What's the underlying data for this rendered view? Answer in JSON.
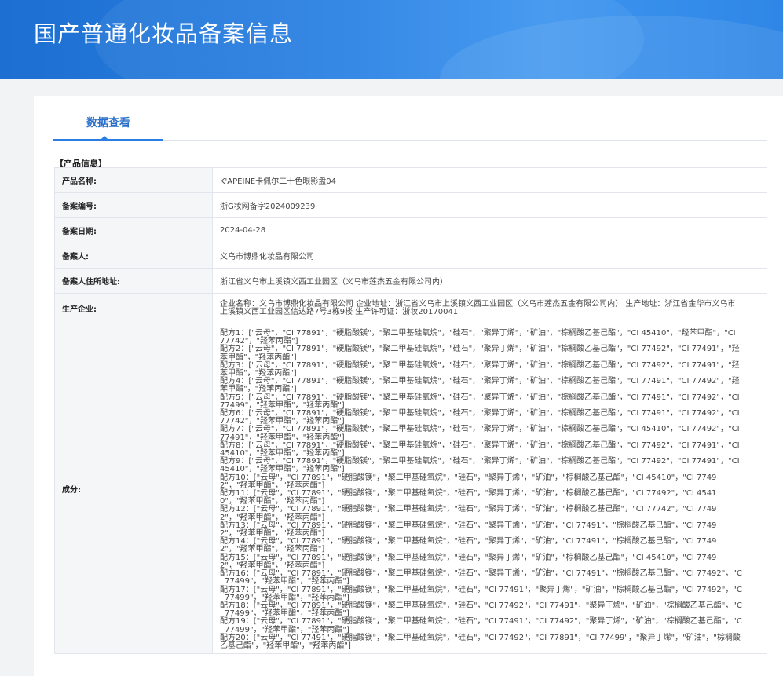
{
  "banner": {
    "title": "国产普通化妆品备案信息"
  },
  "tab": {
    "label": "数据查看"
  },
  "section": {
    "title": "【产品信息】"
  },
  "rows": {
    "product_name": {
      "label": "产品名称:",
      "value": "K'APEINE卡佩尔二十色眼影盘04"
    },
    "record_no": {
      "label": "备案编号:",
      "value": "浙G妆网备字2024009239"
    },
    "record_date": {
      "label": "备案日期:",
      "value": "2024-04-28"
    },
    "registrant": {
      "label": "备案人:",
      "value": "义乌市博鼎化妆品有限公司"
    },
    "registrant_address": {
      "label": "备案人住所地址:",
      "value": "浙江省义乌市上溪镇义西工业园区（义乌市莲杰五金有限公司内）"
    },
    "manufacturer": {
      "label": "生产企业:",
      "value": "企业名称：义乌市博鼎化妆品有限公司 企业地址：浙江省义乌市上溪镇义西工业园区（义乌市莲杰五金有限公司内） 生产地址：浙江省金华市义乌市上溪镇义西工业园区信达路7号3栋9楼 生产许可证：浙妆20170041"
    },
    "ingredients": {
      "label": "成分:",
      "formulas": [
        "配方1：[\"云母\"，\"CI 77891\"，\"硬脂酸镁\"，\"聚二甲基硅氧烷\"，\"硅石\"，\"聚异丁烯\"，\"矿油\"，\"棕榈酸乙基己酯\"，\"CI 45410\"，\"羟苯甲酯\"，\"CI 77742\"，\"羟苯丙酯\"]",
        "配方2：[\"云母\"，\"CI 77891\"，\"硬脂酸镁\"，\"聚二甲基硅氧烷\"，\"硅石\"，\"聚异丁烯\"，\"矿油\"，\"棕榈酸乙基己酯\"，\"CI 77492\"，\"CI 77491\"，\"羟苯甲酯\"，\"羟苯丙酯\"]",
        "配方3：[\"云母\"，\"CI 77891\"，\"硬脂酸镁\"，\"聚二甲基硅氧烷\"，\"硅石\"，\"聚异丁烯\"，\"矿油\"，\"棕榈酸乙基己酯\"，\"CI 77492\"，\"CI 77491\"，\"羟苯甲酯\"，\"羟苯丙酯\"]",
        "配方4：[\"云母\"，\"CI 77891\"，\"硬脂酸镁\"，\"聚二甲基硅氧烷\"，\"硅石\"，\"聚异丁烯\"，\"矿油\"，\"棕榈酸乙基己酯\"，\"CI 77491\"，\"CI 77492\"，\"羟苯甲酯\"，\"羟苯丙酯\"]",
        "配方5：[\"云母\"，\"CI 77891\"，\"硬脂酸镁\"，\"聚二甲基硅氧烷\"，\"硅石\"，\"聚异丁烯\"，\"矿油\"，\"棕榈酸乙基己酯\"，\"CI 77491\"，\"CI 77492\"，\"CI 77499\"，\"羟苯甲酯\"，\"羟苯丙酯\"]",
        "配方6：[\"云母\"，\"CI 77891\"，\"硬脂酸镁\"，\"聚二甲基硅氧烷\"，\"硅石\"，\"聚异丁烯\"，\"矿油\"，\"棕榈酸乙基己酯\"，\"CI 77491\"，\"CI 77492\"，\"CI 77742\"，\"羟苯甲酯\"，\"羟苯丙酯\"]",
        "配方7：[\"云母\"，\"CI 77891\"，\"硬脂酸镁\"，\"聚二甲基硅氧烷\"，\"硅石\"，\"聚异丁烯\"，\"矿油\"，\"棕榈酸乙基己酯\"，\"CI 45410\"，\"CI 77492\"，\"CI 77491\"，\"羟苯甲酯\"，\"羟苯丙酯\"]",
        "配方8：[\"云母\"，\"CI 77891\"，\"硬脂酸镁\"，\"聚二甲基硅氧烷\"，\"硅石\"，\"聚异丁烯\"，\"矿油\"，\"棕榈酸乙基己酯\"，\"CI 77492\"，\"CI 77491\"，\"CI 45410\"，\"羟苯甲酯\"，\"羟苯丙酯\"]",
        "配方9：[\"云母\"，\"CI 77891\"，\"硬脂酸镁\"，\"聚二甲基硅氧烷\"，\"硅石\"，\"聚异丁烯\"，\"矿油\"，\"棕榈酸乙基己酯\"，\"CI 77492\"，\"CI 77491\"，\"CI 45410\"，\"羟苯甲酯\"，\"羟苯丙酯\"]",
        "配方10：[\"云母\"，\"CI 77891\"，\"硬脂酸镁\"，\"聚二甲基硅氧烷\"，\"硅石\"，\"聚异丁烯\"，\"矿油\"，\"棕榈酸乙基己酯\"，\"CI 45410\"，\"CI 77492\"，\"羟苯甲酯\"，\"羟苯丙酯\"]",
        "配方11：[\"云母\"，\"CI 77891\"，\"硬脂酸镁\"，\"聚二甲基硅氧烷\"，\"硅石\"，\"聚异丁烯\"，\"矿油\"，\"棕榈酸乙基己酯\"，\"CI 77492\"，\"CI 45410\"，\"羟苯甲酯\"，\"羟苯丙酯\"]",
        "配方12：[\"云母\"，\"CI 77891\"，\"硬脂酸镁\"，\"聚二甲基硅氧烷\"，\"硅石\"，\"聚异丁烯\"，\"矿油\"，\"棕榈酸乙基己酯\"，\"CI 77742\"，\"CI 77492\"，\"羟苯甲酯\"，\"羟苯丙酯\"]",
        "配方13：[\"云母\"，\"CI 77891\"，\"硬脂酸镁\"，\"聚二甲基硅氧烷\"，\"硅石\"，\"聚异丁烯\"，\"矿油\"，\"CI 77491\"，\"棕榈酸乙基己酯\"，\"CI 77492\"，\"羟苯甲酯\"，\"羟苯丙酯\"]",
        "配方14：[\"云母\"，\"CI 77891\"，\"硬脂酸镁\"，\"聚二甲基硅氧烷\"，\"硅石\"，\"聚异丁烯\"，\"矿油\"，\"CI 77491\"，\"棕榈酸乙基己酯\"，\"CI 77492\"，\"羟苯甲酯\"，\"羟苯丙酯\"]",
        "配方15：[\"云母\"，\"CI 77891\"，\"硬脂酸镁\"，\"聚二甲基硅氧烷\"，\"硅石\"，\"聚异丁烯\"，\"矿油\"，\"棕榈酸乙基己酯\"，\"CI 45410\"，\"CI 77492\"，\"羟苯甲酯\"，\"羟苯丙酯\"]",
        "配方16：[\"云母\"，\"CI 77891\"，\"硬脂酸镁\"，\"聚二甲基硅氧烷\"，\"硅石\"，\"聚异丁烯\"，\"矿油\"，\"CI 77491\"，\"棕榈酸乙基己酯\"，\"CI 77492\"，\"CI 77499\"，\"羟苯甲酯\"，\"羟苯丙酯\"]",
        "配方17：[\"云母\"，\"CI 77891\"，\"硬脂酸镁\"，\"聚二甲基硅氧烷\"，\"硅石\"，\"CI 77491\"，\"聚异丁烯\"，\"矿油\"，\"棕榈酸乙基己酯\"，\"CI 77492\"，\"CI 77499\"，\"羟苯甲酯\"，\"羟苯丙酯\"]",
        "配方18：[\"云母\"，\"CI 77891\"，\"硬脂酸镁\"，\"聚二甲基硅氧烷\"，\"硅石\"，\"CI 77492\"，\"CI 77491\"，\"聚异丁烯\"，\"矿油\"，\"棕榈酸乙基己酯\"，\"CI 77499\"，\"羟苯甲酯\"，\"羟苯丙酯\"]",
        "配方19：[\"云母\"，\"CI 77891\"，\"硬脂酸镁\"，\"聚二甲基硅氧烷\"，\"硅石\"，\"CI 77491\"，\"CI 77492\"，\"聚异丁烯\"，\"矿油\"，\"棕榈酸乙基己酯\"，\"CI 77499\"，\"羟苯甲酯\"，\"羟苯丙酯\"]",
        "配方20：[\"云母\"，\"CI 77491\"，\"硬脂酸镁\"，\"聚二甲基硅氧烷\"，\"硅石\"，\"CI 77492\"，\"CI 77891\"，\"CI 77499\"，\"聚异丁烯\"，\"矿油\"，\"棕榈酸乙基己酯\"，\"羟苯甲酯\"，\"羟苯丙酯\"]"
      ]
    }
  }
}
